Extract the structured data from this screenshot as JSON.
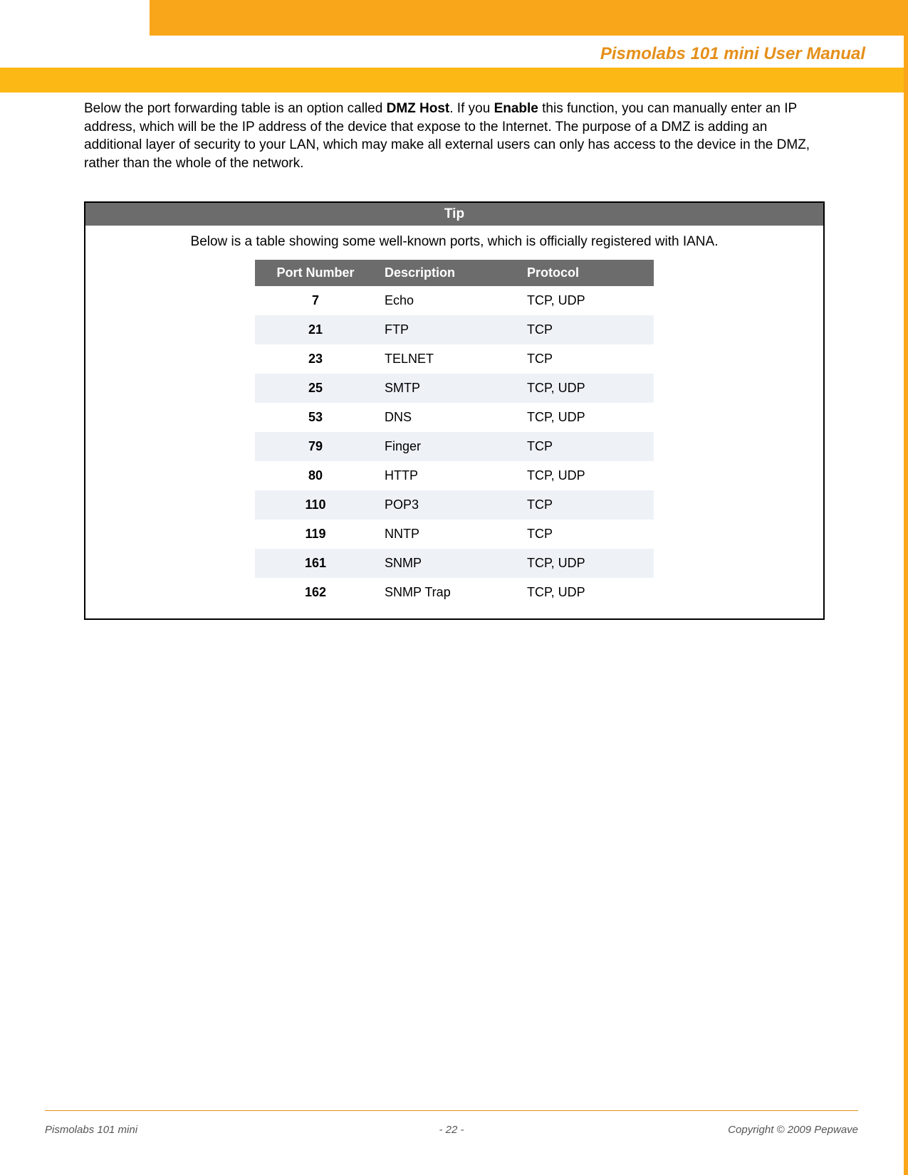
{
  "header": {
    "title": "Pismolabs 101 mini User Manual"
  },
  "body": {
    "p1a": "Below the port forwarding table is an option called ",
    "p1b": "DMZ Host",
    "p1c": ". If you ",
    "p1d": "Enable",
    "p1e": " this function, you can manually enter an IP address, which will be the IP address of the device that expose to the Internet.  The purpose of a DMZ is adding an additional layer of security to your LAN, which may make all external users can only has access to the device in the DMZ, rather than the whole of the network."
  },
  "tip": {
    "header": "Tip",
    "subtitle": "Below is a table showing some well-known ports, which is officially registered with IANA.",
    "columns": {
      "port": "Port Number",
      "desc": "Description",
      "proto": "Protocol"
    },
    "rows": [
      {
        "port": "7",
        "desc": "Echo",
        "proto": "TCP, UDP"
      },
      {
        "port": "21",
        "desc": "FTP",
        "proto": "TCP"
      },
      {
        "port": "23",
        "desc": "TELNET",
        "proto": "TCP"
      },
      {
        "port": "25",
        "desc": "SMTP",
        "proto": "TCP, UDP"
      },
      {
        "port": "53",
        "desc": "DNS",
        "proto": "TCP, UDP"
      },
      {
        "port": "79",
        "desc": "Finger",
        "proto": "TCP"
      },
      {
        "port": "80",
        "desc": "HTTP",
        "proto": "TCP, UDP"
      },
      {
        "port": "110",
        "desc": "POP3",
        "proto": "TCP"
      },
      {
        "port": "119",
        "desc": "NNTP",
        "proto": "TCP"
      },
      {
        "port": "161",
        "desc": "SNMP",
        "proto": "TCP, UDP"
      },
      {
        "port": "162",
        "desc": "SNMP Trap",
        "proto": "TCP, UDP"
      }
    ]
  },
  "footer": {
    "left": "Pismolabs 101 mini",
    "center": "- 22 -",
    "right": "Copyright © 2009 Pepwave"
  }
}
